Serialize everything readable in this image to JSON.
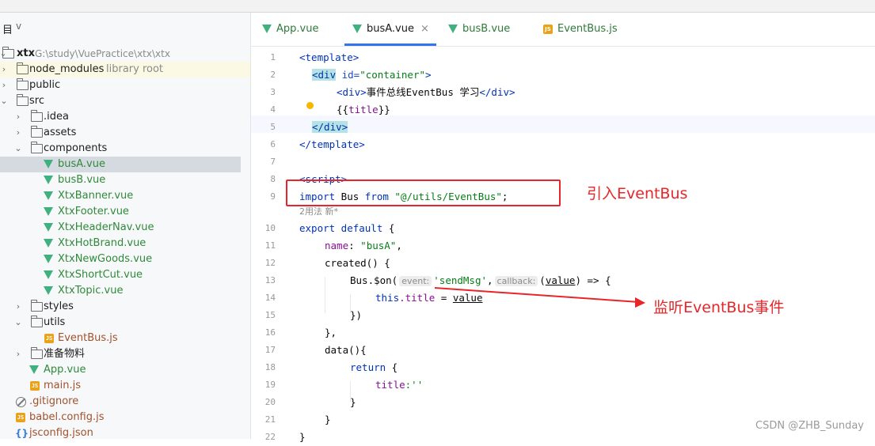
{
  "project_panel": {
    "title": "目",
    "chevron": "v",
    "tree": [
      {
        "label": "xtx",
        "hint": "G:\\study\\VuePractice\\xtx\\xtx",
        "type": "root-folder",
        "expanded": true
      },
      {
        "label": "node_modules",
        "hint": "library root",
        "type": "folder",
        "expanded": false
      },
      {
        "label": "public",
        "type": "folder",
        "expanded": false
      },
      {
        "label": "src",
        "type": "folder",
        "expanded": true
      },
      {
        "label": ".idea",
        "type": "folder",
        "expanded": false
      },
      {
        "label": "assets",
        "type": "folder",
        "expanded": false
      },
      {
        "label": "components",
        "type": "folder",
        "expanded": true
      },
      {
        "label": "busA.vue",
        "type": "vue",
        "selected": true
      },
      {
        "label": "busB.vue",
        "type": "vue"
      },
      {
        "label": "XtxBanner.vue",
        "type": "vue"
      },
      {
        "label": "XtxFooter.vue",
        "type": "vue"
      },
      {
        "label": "XtxHeaderNav.vue",
        "type": "vue"
      },
      {
        "label": "XtxHotBrand.vue",
        "type": "vue"
      },
      {
        "label": "XtxNewGoods.vue",
        "type": "vue"
      },
      {
        "label": "XtxShortCut.vue",
        "type": "vue"
      },
      {
        "label": "XtxTopic.vue",
        "type": "vue"
      },
      {
        "label": "styles",
        "type": "folder",
        "expanded": false
      },
      {
        "label": "utils",
        "type": "folder",
        "expanded": true
      },
      {
        "label": "EventBus.js",
        "type": "js"
      },
      {
        "label": "准备物料",
        "type": "folder",
        "expanded": false
      },
      {
        "label": "App.vue",
        "type": "vue"
      },
      {
        "label": "main.js",
        "type": "js"
      },
      {
        "label": ".gitignore",
        "type": "gitignore"
      },
      {
        "label": "babel.config.js",
        "type": "js"
      },
      {
        "label": "jsconfig.json",
        "type": "json"
      }
    ]
  },
  "editor_tabs": [
    {
      "label": "App.vue",
      "icon": "vue-icon"
    },
    {
      "label": "busA.vue",
      "icon": "vue-icon",
      "active": true,
      "close": "×"
    },
    {
      "label": "busB.vue",
      "icon": "vue-icon"
    },
    {
      "label": "EventBus.js",
      "icon": "js-icon"
    }
  ],
  "code": {
    "line_numbers": [
      "1",
      "2",
      "3",
      "4",
      "5",
      "6",
      "7",
      "8",
      "9",
      "10",
      "11",
      "12",
      "13",
      "14",
      "15",
      "16",
      "17",
      "18",
      "19",
      "20",
      "21",
      "22"
    ],
    "usage_hint": "2用法  新*",
    "hints": {
      "event": "event:",
      "callback": "callback:"
    },
    "tokens": {
      "template_open": "<template>",
      "div_open": "<div",
      "id_attr": " id=",
      "id_val": "\"container\"",
      "gt": ">",
      "inner_div": "<div>",
      "inner_text": "事件总线EventBus 学习",
      "inner_div_close": "</div>",
      "mustache": "{{",
      "title": "title",
      "mustache_close": "}}",
      "div_close": "</div>",
      "template_close": "</template>",
      "script_open": "<script>",
      "import": "import",
      "bus": " Bus ",
      "from": "from",
      "import_path": " \"@/utils/EventBus\"",
      "semi": ";",
      "export_default": "export default",
      "brace_open": " {",
      "name_key": "name",
      "name_colon": ": ",
      "name_val": "\"busA\"",
      "comma": ",",
      "created": "created() {",
      "bus_on": "Bus.$on(",
      "send_msg": "'sendMsg'",
      "comma2": ",",
      "value_param": "value",
      "arrow": ") => {",
      "this": "this",
      "dot_title": ".title",
      "assign": " = ",
      "value": "value",
      "close_paren": "})",
      "close_brace_comma": "},",
      "data": "data(){",
      "return": "return",
      "return_brace": " {",
      "title_key": "title",
      "title_val": ":''",
      "close_brace": "}",
      "close_brace2": "}",
      "final_brace": "}"
    }
  },
  "annotations": {
    "import_note": "引入EventBus",
    "listen_note": "监听EventBus事件"
  },
  "watermark": "CSDN @ZHB_Sunday",
  "colors": {
    "annotation": "#e8262a",
    "vue": "#3fb07e",
    "js": "#e9a21a",
    "active_tab": "#3574f0"
  }
}
